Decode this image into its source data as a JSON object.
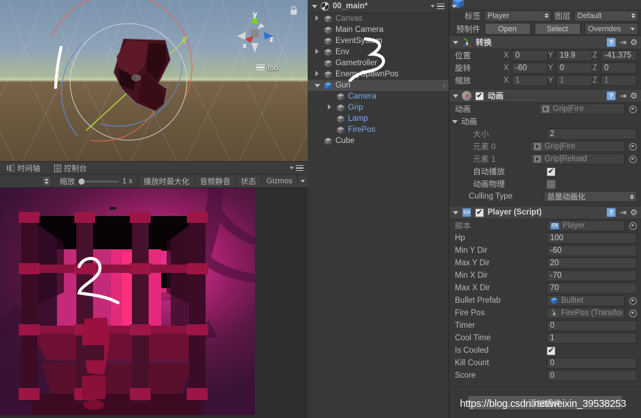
{
  "scene_view": {
    "name": "scene-view",
    "view_mode_label": "Iso",
    "axis_labels": {
      "x": "x",
      "y": "y",
      "z": "z"
    },
    "lock_icon": "lock-icon"
  },
  "lower_tabs": [
    {
      "label": "时间轴",
      "icon": "timeline-icon",
      "active": false
    },
    {
      "label": "控制台",
      "icon": "console-icon",
      "active": false
    }
  ],
  "game_toolbar": {
    "scale_label": "缩放",
    "scale_value": "1 x",
    "maximize_on_play": "播放时最大化",
    "mute_audio": "音频静音",
    "stats": "状态",
    "gizmos": "Gizmos"
  },
  "hierarchy": {
    "scene_name": "00_main*",
    "items": [
      {
        "label": "Canvas",
        "indent": 1,
        "twisty": "right",
        "selected": false,
        "prefab": false,
        "dim": true
      },
      {
        "label": "Main Camera",
        "indent": 1,
        "twisty": "none",
        "selected": false,
        "prefab": false,
        "dim": false
      },
      {
        "label": "EventSystem",
        "indent": 1,
        "twisty": "none",
        "selected": false,
        "prefab": false,
        "dim": false
      },
      {
        "label": "Env",
        "indent": 1,
        "twisty": "right",
        "selected": false,
        "prefab": false,
        "dim": false
      },
      {
        "label": "Gametroller",
        "indent": 1,
        "twisty": "none",
        "selected": false,
        "prefab": false,
        "dim": false
      },
      {
        "label": "EnemySpawnPos",
        "indent": 1,
        "twisty": "right",
        "selected": false,
        "prefab": false,
        "dim": false
      },
      {
        "label": "Gun",
        "indent": 1,
        "twisty": "down",
        "selected": true,
        "prefab": true,
        "dim": false
      },
      {
        "label": "Camera",
        "indent": 2,
        "twisty": "none",
        "selected": false,
        "prefab": false,
        "dim": false,
        "blue": true
      },
      {
        "label": "Grip",
        "indent": 2,
        "twisty": "right",
        "selected": false,
        "prefab": false,
        "dim": false,
        "blue": true
      },
      {
        "label": "Lamp",
        "indent": 2,
        "twisty": "none",
        "selected": false,
        "prefab": false,
        "dim": false,
        "blue": true
      },
      {
        "label": "FirePos",
        "indent": 2,
        "twisty": "none",
        "selected": false,
        "prefab": false,
        "dim": false,
        "blue": true
      },
      {
        "label": "Cube",
        "indent": 1,
        "twisty": "none",
        "selected": false,
        "prefab": false,
        "dim": false
      }
    ]
  },
  "inspector": {
    "tag_label": "标签",
    "tag_value": "Player",
    "layer_label": "图层",
    "layer_value": "Default",
    "prefab_label": "预制件",
    "open_button": "Open",
    "select_button": "Select",
    "overrides_button": "Overrides",
    "transform": {
      "title": "转换",
      "position_label": "位置",
      "position": {
        "x": "0",
        "y": "19.9",
        "z": "-41.375"
      },
      "rotation_label": "旋转",
      "rotation": {
        "x": "-60",
        "y": "0",
        "z": "0"
      },
      "scale_label": "缩放",
      "scale": {
        "x": "1",
        "y": "1",
        "z": "1"
      },
      "axis": {
        "x": "X",
        "y": "Y",
        "z": "Z"
      }
    },
    "animation_component": {
      "title": "动画",
      "enabled": true,
      "animation_label": "动画",
      "animation_value": "Grip|Fire",
      "animations_array_label": "动画",
      "size_label": "大小",
      "size_value": "2",
      "elements": [
        {
          "label": "元素 0",
          "value": "Grip|Fire"
        },
        {
          "label": "元素 1",
          "value": "Grip|Reload"
        }
      ],
      "play_automatically_label": "自动播放",
      "play_automatically": true,
      "animate_physics_label": "动画物理",
      "animate_physics": false,
      "culling_type_label": "Culling Type",
      "culling_type_value": "总是动画化"
    },
    "player_component": {
      "title": "Player  (Script)",
      "enabled": true,
      "script_label": "脚本",
      "script_value": "Player",
      "fields": [
        {
          "name": "Hp",
          "value": "100",
          "type": "number"
        },
        {
          "name": "Min Y Dir",
          "value": "-60",
          "type": "number"
        },
        {
          "name": "Max Y Dir",
          "value": "20",
          "type": "number"
        },
        {
          "name": "Min X Dir",
          "value": "-70",
          "type": "number"
        },
        {
          "name": "Max X Dir",
          "value": "70",
          "type": "number"
        },
        {
          "name": "Bullet Prefab",
          "value": "Bulltet",
          "type": "object-prefab"
        },
        {
          "name": "Fire Pos",
          "value": "FirePos (Transform",
          "type": "object-transform"
        },
        {
          "name": "Timer",
          "value": "0",
          "type": "number"
        },
        {
          "name": "Cool Time",
          "value": "1",
          "type": "number"
        },
        {
          "name": "Is Cooled",
          "value": "true",
          "type": "checkbox"
        },
        {
          "name": "Kill Count",
          "value": "0",
          "type": "number"
        },
        {
          "name": "Score",
          "value": "0",
          "type": "number"
        }
      ]
    },
    "add_component_button": "添加组件"
  },
  "watermark": "https://blog.csdn.net/weixin_39538253",
  "colors": {
    "panel_bg": "#383838",
    "header_bg": "#424242",
    "field_bg": "#424242",
    "selection": "#4b4b4b",
    "prefab_blue": "#7aaaf0",
    "accent_red": "#e4402e",
    "game_magenta": "#e0379a"
  }
}
